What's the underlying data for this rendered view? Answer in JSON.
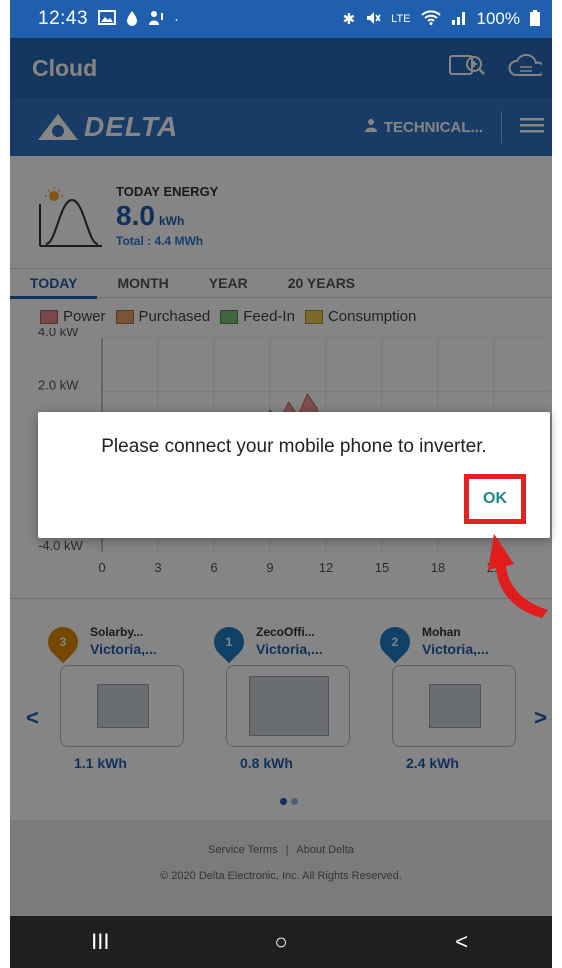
{
  "status_bar": {
    "time": "12:43",
    "battery": "100%",
    "network": "LTE"
  },
  "app_bar": {
    "title": "Cloud",
    "icons": [
      "search-cloud-icon",
      "cloud-icon"
    ]
  },
  "header": {
    "brand": "DELTA",
    "user": "TECHNICAL..."
  },
  "today_energy": {
    "label": "TODAY ENERGY",
    "value": "8.0",
    "unit": "kWh",
    "total": "Total : 4.4 MWh"
  },
  "tabs": [
    {
      "label": "TODAY",
      "active": true
    },
    {
      "label": "MONTH",
      "active": false
    },
    {
      "label": "YEAR",
      "active": false
    },
    {
      "label": "20 YEARS",
      "active": false
    }
  ],
  "chart_data": {
    "type": "area",
    "legend": [
      {
        "name": "Power",
        "color": "#e98d8d"
      },
      {
        "name": "Purchased",
        "color": "#e8a36a"
      },
      {
        "name": "Feed-In",
        "color": "#7cc47a"
      },
      {
        "name": "Consumption",
        "color": "#eccc55"
      }
    ],
    "ytick_labels": [
      "4.0 kW",
      "2.0 kW",
      "-4.0 kW"
    ],
    "xticks": [
      0,
      3,
      6,
      9,
      12,
      15,
      18,
      21
    ],
    "xlim": [
      0,
      24
    ],
    "ylim": [
      -4,
      4
    ],
    "series": [
      {
        "name": "Power",
        "x": [
          8,
          8.5,
          9,
          9.5,
          10,
          10.5,
          11,
          11.5,
          12
        ],
        "values": [
          0,
          0.4,
          1.3,
          0.9,
          1.6,
          1.1,
          1.9,
          1.4,
          0
        ]
      }
    ]
  },
  "dialog": {
    "message": "Please connect your mobile phone to inverter.",
    "ok_label": "OK"
  },
  "sites": [
    {
      "badge": "3",
      "badge_color": "#e08a00",
      "name": "Solarby...",
      "location": "Victoria,...",
      "energy": "1.1 kWh"
    },
    {
      "badge": "1",
      "badge_color": "#1f7fc8",
      "name": "ZecoOffi...",
      "location": "Victoria,...",
      "energy": "0.8 kWh"
    },
    {
      "badge": "2",
      "badge_color": "#1f7fc8",
      "name": "Mohan",
      "location": "Victoria,...",
      "energy": "2.4 kWh"
    }
  ],
  "site_nav": {
    "prev": "<",
    "next": ">"
  },
  "footer": {
    "service_terms": "Service Terms",
    "separator": "|",
    "about": "About Delta",
    "copyright": "© 2020 Delta Electronic, Inc. All Rights Reserved."
  },
  "nav_bar": {
    "recent": "III",
    "home": "○",
    "back": "<"
  },
  "colors": {
    "primary": "#1f5fae",
    "highlight": "#e32222"
  }
}
